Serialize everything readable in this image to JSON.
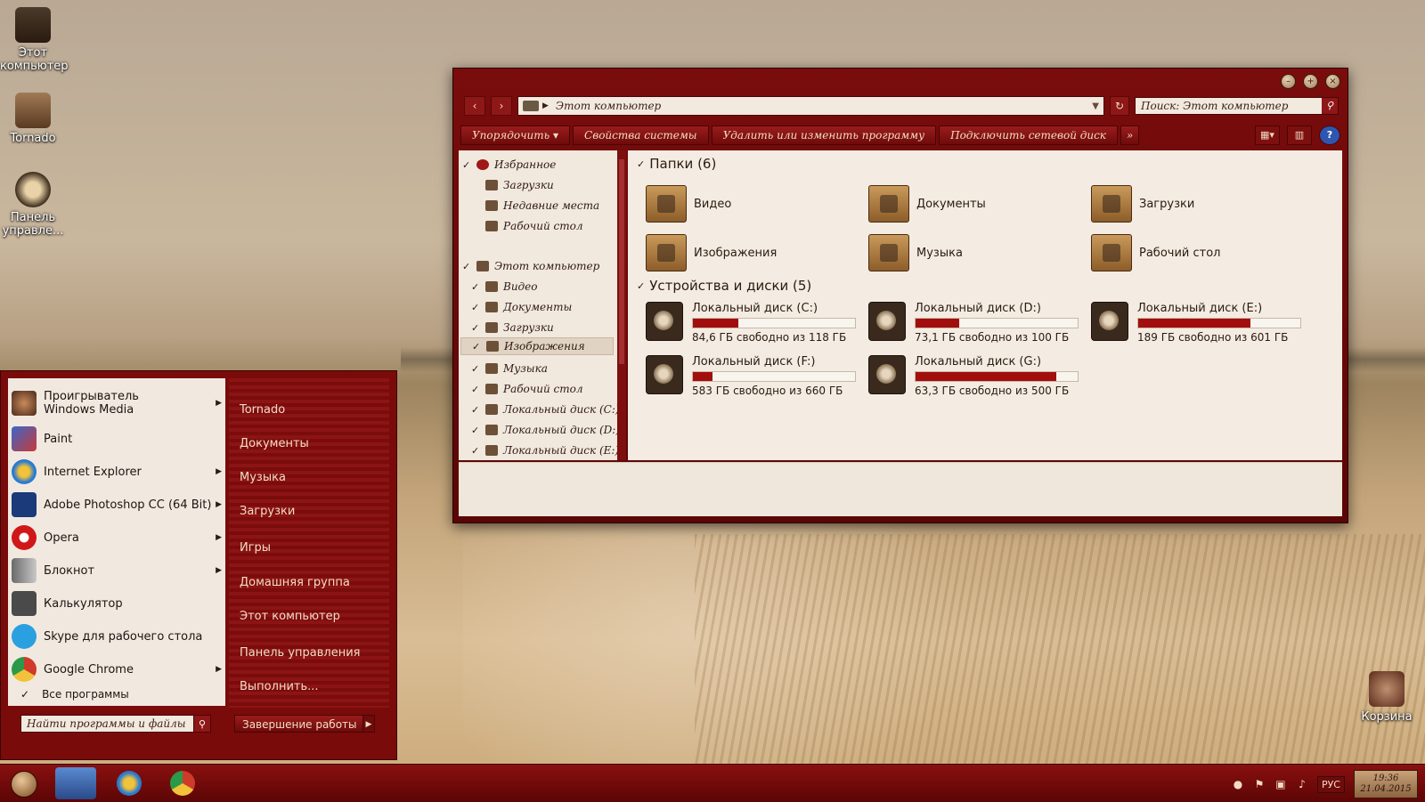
{
  "desktop": {
    "icons": [
      {
        "label": "Этот компьютер"
      },
      {
        "label": "Tornado"
      },
      {
        "label": "Панель управле..."
      },
      {
        "label": "Корзина"
      }
    ]
  },
  "explorer": {
    "address": "Этот компьютер",
    "search_placeholder": "Поиск: Этот компьютер",
    "toolbar": {
      "organize": "Упорядочить",
      "system_props": "Свойства системы",
      "uninstall": "Удалить или изменить программу",
      "map_drive": "Подключить сетевой диск",
      "more": "»"
    },
    "nav": {
      "favorites": "Избранное",
      "downloads": "Загрузки",
      "recent": "Недавние места",
      "desktop": "Рабочий стол",
      "computer": "Этот компьютер",
      "video": "Видео",
      "documents": "Документы",
      "downloads2": "Загрузки",
      "images": "Изображения",
      "music": "Музыка",
      "desktop2": "Рабочий стол",
      "disk_c": "Локальный диск (C:)",
      "disk_d": "Локальный диск (D:)",
      "disk_e": "Локальный диск (E:)"
    },
    "folders_header": "Папки (6)",
    "folders": [
      "Видео",
      "Документы",
      "Загрузки",
      "Изображения",
      "Музыка",
      "Рабочий стол"
    ],
    "devices_header": "Устройства и диски (5)",
    "drives": [
      {
        "name": "Локальный диск (C:)",
        "info": "84,6 ГБ свободно из 118 ГБ",
        "used_fraction": 0.28
      },
      {
        "name": "Локальный диск (D:)",
        "info": "73,1 ГБ свободно из 100 ГБ",
        "used_fraction": 0.27
      },
      {
        "name": "Локальный диск (E:)",
        "info": "189 ГБ свободно из 601 ГБ",
        "used_fraction": 0.69
      },
      {
        "name": "Локальный диск (F:)",
        "info": "583 ГБ свободно из 660 ГБ",
        "used_fraction": 0.12
      },
      {
        "name": "Локальный диск (G:)",
        "info": "63,3 ГБ свободно из 500 ГБ",
        "used_fraction": 0.87
      }
    ]
  },
  "start_menu": {
    "programs": [
      {
        "label": "Проигрыватель Windows Media",
        "arrow": true
      },
      {
        "label": "Paint",
        "arrow": false
      },
      {
        "label": "Internet Explorer",
        "arrow": true
      },
      {
        "label": "Adobe Photoshop CC (64 Bit)",
        "arrow": true
      },
      {
        "label": "Opera",
        "arrow": true
      },
      {
        "label": "Блокнот",
        "arrow": true
      },
      {
        "label": "Калькулятор",
        "arrow": false
      },
      {
        "label": "Skype для рабочего стола",
        "arrow": false
      },
      {
        "label": "Google Chrome",
        "arrow": true
      }
    ],
    "all_programs": "Все программы",
    "search_placeholder": "Найти программы и файлы",
    "places": [
      "Tornado",
      "Документы",
      "Музыка",
      "Загрузки",
      "Игры",
      "Домашняя группа",
      "Этот компьютер",
      "Панель управления",
      "Выполнить..."
    ],
    "shutdown": "Завершение работы"
  },
  "taskbar": {
    "language": "РУС",
    "time": "19:36",
    "date": "21.04.2015"
  },
  "colors": {
    "accent": "#7a0b0b",
    "bar_fill": "#a20e0e",
    "pane": "#f1e8de"
  }
}
